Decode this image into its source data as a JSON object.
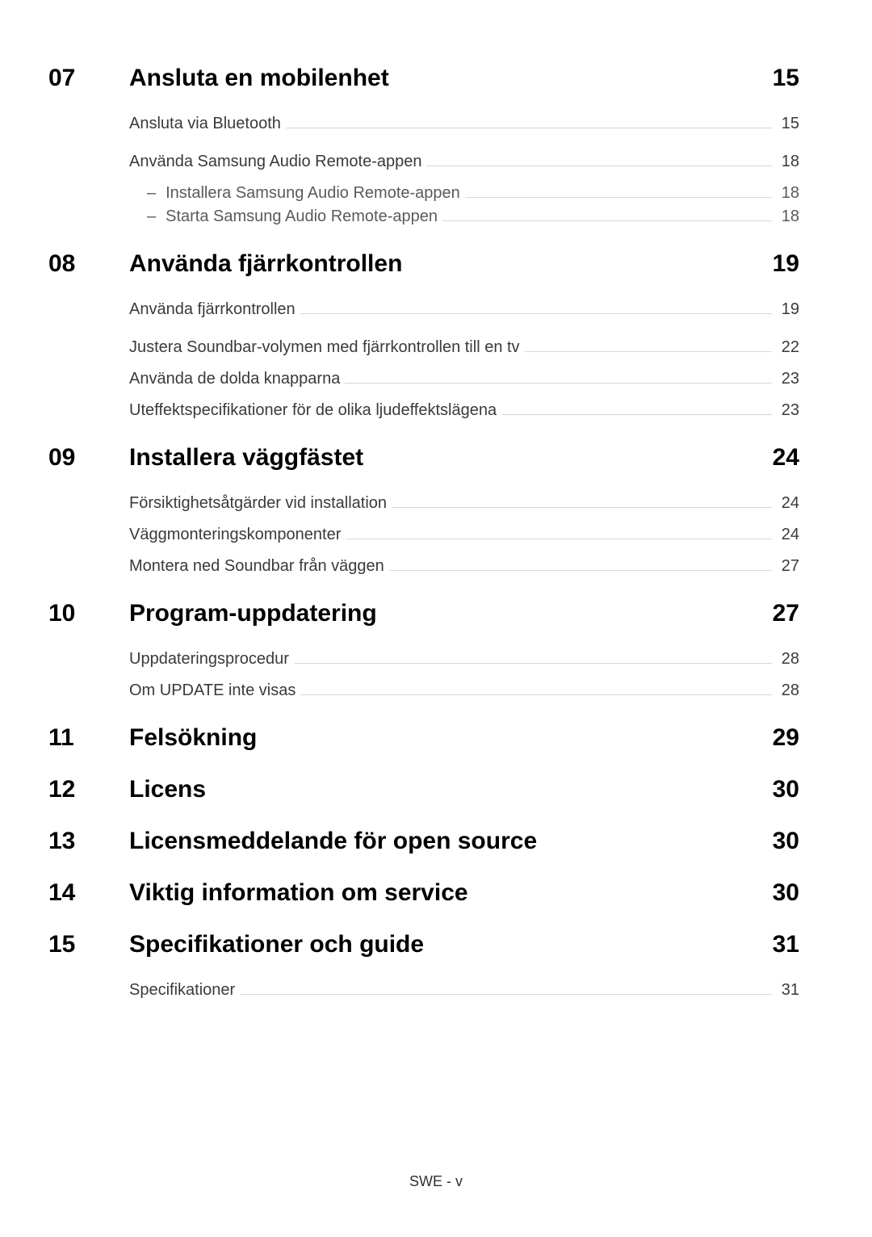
{
  "sections": [
    {
      "number": "07",
      "title": "Ansluta en mobilenhet",
      "page": "15",
      "groups": [
        {
          "items": [
            {
              "label": "Ansluta via Bluetooth",
              "page": "15"
            }
          ]
        },
        {
          "items": [
            {
              "label": "Använda Samsung Audio Remote-appen",
              "page": "18",
              "subs": [
                {
                  "label": "Installera Samsung Audio Remote-appen",
                  "page": "18"
                },
                {
                  "label": "Starta Samsung Audio Remote-appen",
                  "page": "18"
                }
              ]
            }
          ]
        }
      ]
    },
    {
      "number": "08",
      "title": "Använda fjärrkontrollen",
      "page": "19",
      "groups": [
        {
          "items": [
            {
              "label": "Använda fjärrkontrollen",
              "page": "19"
            }
          ]
        },
        {
          "items": [
            {
              "label": "Justera Soundbar-volymen med fjärrkontrollen till en tv",
              "page": "22"
            },
            {
              "label": "Använda de dolda knapparna",
              "page": "23"
            },
            {
              "label": "Uteffektspecifikationer för de olika ljudeffektslägena",
              "page": "23"
            }
          ]
        }
      ]
    },
    {
      "number": "09",
      "title": "Installera väggfästet",
      "page": "24",
      "groups": [
        {
          "items": [
            {
              "label": "Försiktighetsåtgärder vid installation",
              "page": "24"
            },
            {
              "label": "Väggmonteringskomponenter",
              "page": "24"
            },
            {
              "label": "Montera ned Soundbar från väggen",
              "page": "27"
            }
          ]
        }
      ]
    },
    {
      "number": "10",
      "title": "Program-uppdatering",
      "page": "27",
      "groups": [
        {
          "items": [
            {
              "label": "Uppdateringsprocedur",
              "page": "28"
            },
            {
              "label": "Om UPDATE inte visas",
              "page": "28"
            }
          ]
        }
      ]
    },
    {
      "number": "11",
      "title": "Felsökning",
      "page": "29",
      "groups": []
    },
    {
      "number": "12",
      "title": "Licens",
      "page": "30",
      "groups": []
    },
    {
      "number": "13",
      "title": "Licensmeddelande för open source",
      "page": "30",
      "groups": []
    },
    {
      "number": "14",
      "title": "Viktig information om service",
      "page": "30",
      "groups": []
    },
    {
      "number": "15",
      "title": "Specifikationer och guide",
      "page": "31",
      "groups": [
        {
          "items": [
            {
              "label": "Specifikationer",
              "page": "31"
            }
          ]
        }
      ]
    }
  ],
  "footer": "SWE - v"
}
